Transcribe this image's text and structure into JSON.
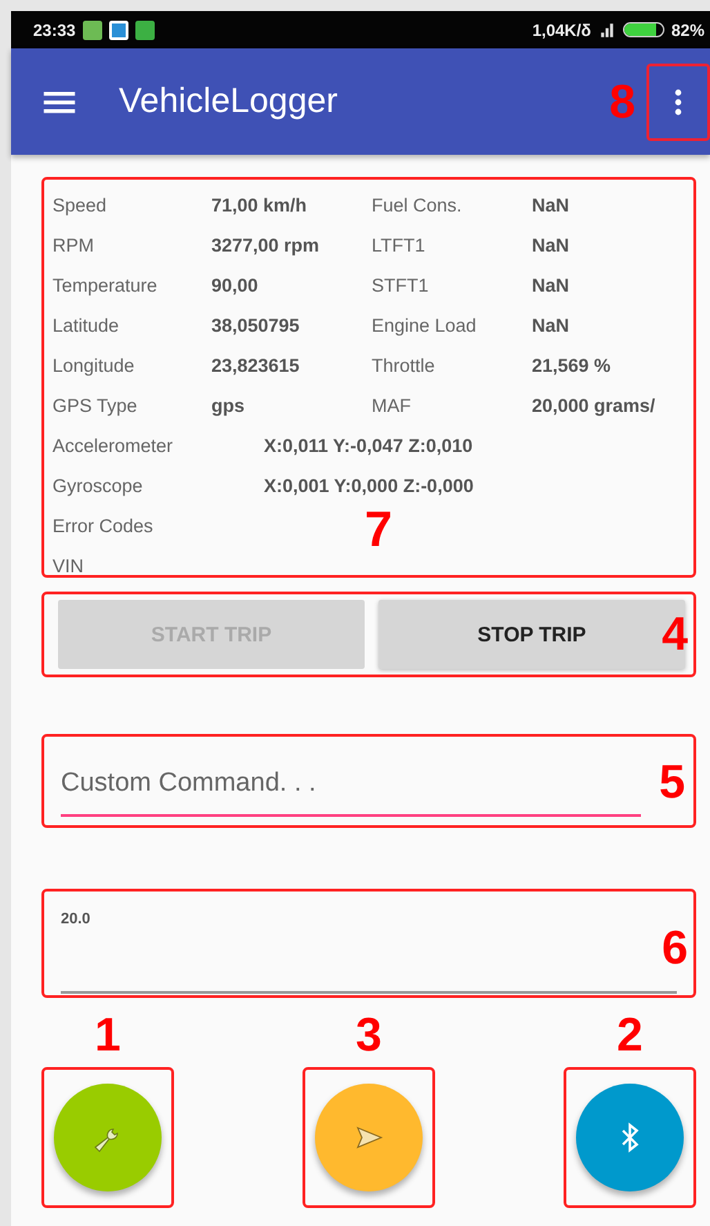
{
  "status_bar": {
    "time": "23:33",
    "network_speed": "1,04K/δ",
    "battery": "82%"
  },
  "app_bar": {
    "title": "VehicleLogger",
    "callout": "8"
  },
  "readings": {
    "callout": "7",
    "rows": [
      {
        "kind": "double",
        "label": "Speed",
        "value": "71,00 km/h",
        "label_2": "Fuel Cons.",
        "value_2": "NaN"
      },
      {
        "kind": "double",
        "label": "RPM",
        "value": "3277,00 rpm",
        "label_2": "LTFT1",
        "value_2": "NaN"
      },
      {
        "kind": "double",
        "label": "Temperature",
        "value": "90,00",
        "label_2": "STFT1",
        "value_2": "NaN"
      },
      {
        "kind": "double",
        "label": "Latitude",
        "value": "38,050795",
        "label_2": "Engine Load",
        "value_2": "NaN"
      },
      {
        "kind": "double",
        "label": "Longitude",
        "value": "23,823615",
        "label_2": "Throttle",
        "value_2": "21,569 %"
      },
      {
        "kind": "double",
        "label": "GPS Type",
        "value": "gps",
        "label_2": "MAF",
        "value_2": "20,000 grams/"
      },
      {
        "kind": "wide",
        "label": "Accelerometer",
        "value": "X:0,011 Y:-0,047 Z:0,010"
      },
      {
        "kind": "wide",
        "label": "Gyroscope",
        "value": "X:0,001 Y:0,000 Z:-0,000"
      },
      {
        "kind": "single",
        "label": "Error Codes"
      },
      {
        "kind": "single",
        "label": "VIN"
      }
    ]
  },
  "trip_buttons": {
    "callout": "4",
    "buttons": [
      {
        "label": "START TRIP",
        "disabled": true
      },
      {
        "label": "STOP TRIP",
        "disabled": false
      }
    ]
  },
  "command_field": {
    "placeholder": "Custom Command. . .",
    "focused": true,
    "callout": "5"
  },
  "output_field": {
    "value": "20.0",
    "focused": false,
    "callout": "6"
  },
  "fabs": [
    {
      "kind": "wrench",
      "color": "#99cc00",
      "callout": "1"
    },
    {
      "kind": "send",
      "color": "#ffb92e",
      "callout": "3"
    },
    {
      "kind": "bluetooth",
      "color": "#0099cc",
      "callout": "2"
    }
  ]
}
